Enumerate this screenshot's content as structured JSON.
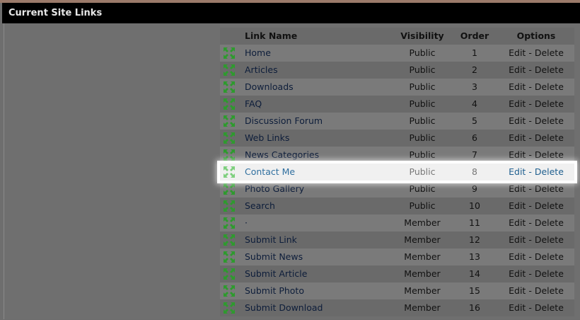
{
  "panel": {
    "title": "Current Site Links"
  },
  "table": {
    "headers": {
      "name": "Link Name",
      "visibility": "Visibility",
      "order": "Order",
      "options": "Options"
    },
    "edit_label": "Edit",
    "separator": "-",
    "delete_label": "Delete",
    "icon": "move-arrows-icon",
    "highlight_row": 7,
    "rows": [
      {
        "name": "Home",
        "visibility": "Public",
        "order": "1"
      },
      {
        "name": "Articles",
        "visibility": "Public",
        "order": "2"
      },
      {
        "name": "Downloads",
        "visibility": "Public",
        "order": "3"
      },
      {
        "name": "FAQ",
        "visibility": "Public",
        "order": "4"
      },
      {
        "name": "Discussion Forum",
        "visibility": "Public",
        "order": "5"
      },
      {
        "name": "Web Links",
        "visibility": "Public",
        "order": "6"
      },
      {
        "name": "News Categories",
        "visibility": "Public",
        "order": "7"
      },
      {
        "name": "Contact Me",
        "visibility": "Public",
        "order": "8"
      },
      {
        "name": "Photo Gallery",
        "visibility": "Public",
        "order": "9"
      },
      {
        "name": "Search",
        "visibility": "Public",
        "order": "10"
      },
      {
        "name": "·",
        "visibility": "Member",
        "order": "11"
      },
      {
        "name": "Submit Link",
        "visibility": "Member",
        "order": "12"
      },
      {
        "name": "Submit News",
        "visibility": "Member",
        "order": "13"
      },
      {
        "name": "Submit Article",
        "visibility": "Member",
        "order": "14"
      },
      {
        "name": "Submit Photo",
        "visibility": "Member",
        "order": "15"
      },
      {
        "name": "Submit Download",
        "visibility": "Member",
        "order": "16"
      }
    ]
  },
  "colors": {
    "icon_green": "#2e9a2e",
    "titlebar": "#000000",
    "link_highlight": "#2f6f9f"
  }
}
